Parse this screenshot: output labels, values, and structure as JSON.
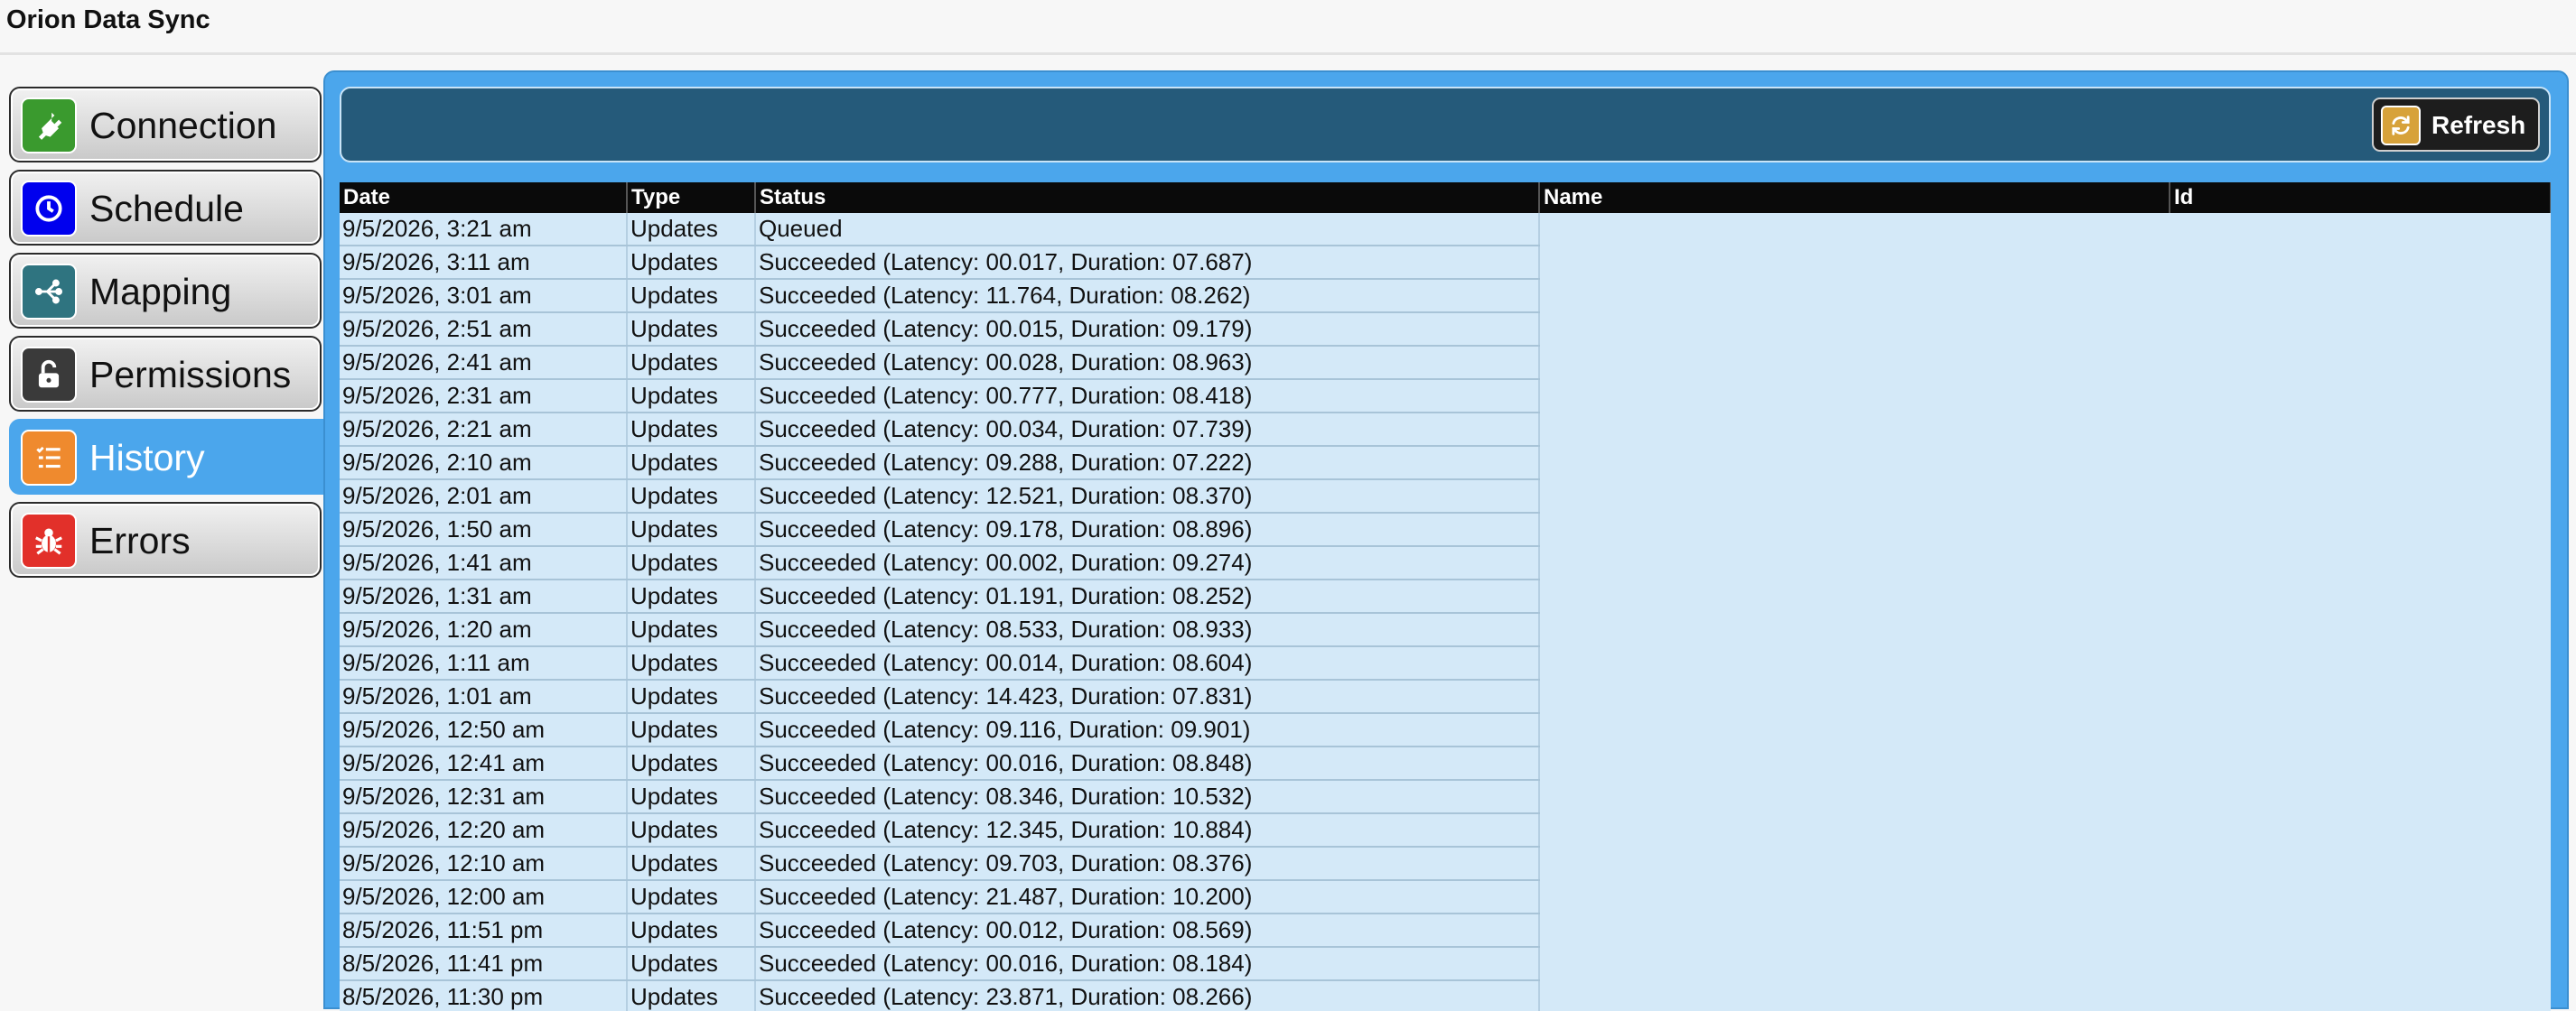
{
  "app": {
    "title": "Orion Data Sync"
  },
  "sidebar": {
    "items": [
      {
        "label": "Connection",
        "icon": "plug-icon",
        "color": "#3a9a2e",
        "active": false
      },
      {
        "label": "Schedule",
        "icon": "clock-icon",
        "color": "#0000ee",
        "active": false
      },
      {
        "label": "Mapping",
        "icon": "flow-icon",
        "color": "#2f7480",
        "active": false
      },
      {
        "label": "Permissions",
        "icon": "unlock-icon",
        "color": "#3a3a3a",
        "active": false
      },
      {
        "label": "History",
        "icon": "list-icon",
        "color": "#ef8a2e",
        "active": true
      },
      {
        "label": "Errors",
        "icon": "bug-icon",
        "color": "#e2302a",
        "active": false
      }
    ]
  },
  "toolbar": {
    "refresh_label": "Refresh",
    "refresh_icon": "refresh-icon",
    "refresh_color": "#d7a23a"
  },
  "table": {
    "columns": [
      "Date",
      "Type",
      "Status",
      "Name",
      "Id"
    ],
    "rows": [
      [
        "9/5/2026, 3:21 am",
        "Updates",
        "Queued"
      ],
      [
        "9/5/2026, 3:11 am",
        "Updates",
        "Succeeded (Latency: 00.017, Duration: 07.687)"
      ],
      [
        "9/5/2026, 3:01 am",
        "Updates",
        "Succeeded (Latency: 11.764, Duration: 08.262)"
      ],
      [
        "9/5/2026, 2:51 am",
        "Updates",
        "Succeeded (Latency: 00.015, Duration: 09.179)"
      ],
      [
        "9/5/2026, 2:41 am",
        "Updates",
        "Succeeded (Latency: 00.028, Duration: 08.963)"
      ],
      [
        "9/5/2026, 2:31 am",
        "Updates",
        "Succeeded (Latency: 00.777, Duration: 08.418)"
      ],
      [
        "9/5/2026, 2:21 am",
        "Updates",
        "Succeeded (Latency: 00.034, Duration: 07.739)"
      ],
      [
        "9/5/2026, 2:10 am",
        "Updates",
        "Succeeded (Latency: 09.288, Duration: 07.222)"
      ],
      [
        "9/5/2026, 2:01 am",
        "Updates",
        "Succeeded (Latency: 12.521, Duration: 08.370)"
      ],
      [
        "9/5/2026, 1:50 am",
        "Updates",
        "Succeeded (Latency: 09.178, Duration: 08.896)"
      ],
      [
        "9/5/2026, 1:41 am",
        "Updates",
        "Succeeded (Latency: 00.002, Duration: 09.274)"
      ],
      [
        "9/5/2026, 1:31 am",
        "Updates",
        "Succeeded (Latency: 01.191, Duration: 08.252)"
      ],
      [
        "9/5/2026, 1:20 am",
        "Updates",
        "Succeeded (Latency: 08.533, Duration: 08.933)"
      ],
      [
        "9/5/2026, 1:11 am",
        "Updates",
        "Succeeded (Latency: 00.014, Duration: 08.604)"
      ],
      [
        "9/5/2026, 1:01 am",
        "Updates",
        "Succeeded (Latency: 14.423, Duration: 07.831)"
      ],
      [
        "9/5/2026, 12:50 am",
        "Updates",
        "Succeeded (Latency: 09.116, Duration: 09.901)"
      ],
      [
        "9/5/2026, 12:41 am",
        "Updates",
        "Succeeded (Latency: 00.016, Duration: 08.848)"
      ],
      [
        "9/5/2026, 12:31 am",
        "Updates",
        "Succeeded (Latency: 08.346, Duration: 10.532)"
      ],
      [
        "9/5/2026, 12:20 am",
        "Updates",
        "Succeeded (Latency: 12.345, Duration: 10.884)"
      ],
      [
        "9/5/2026, 12:10 am",
        "Updates",
        "Succeeded (Latency: 09.703, Duration: 08.376)"
      ],
      [
        "9/5/2026, 12:00 am",
        "Updates",
        "Succeeded (Latency: 21.487, Duration: 10.200)"
      ],
      [
        "8/5/2026, 11:51 pm",
        "Updates",
        "Succeeded (Latency: 00.012, Duration: 08.569)"
      ],
      [
        "8/5/2026, 11:41 pm",
        "Updates",
        "Succeeded (Latency: 00.016, Duration: 08.184)"
      ],
      [
        "8/5/2026, 11:30 pm",
        "Updates",
        "Succeeded (Latency: 23.871, Duration: 08.266)"
      ]
    ]
  }
}
